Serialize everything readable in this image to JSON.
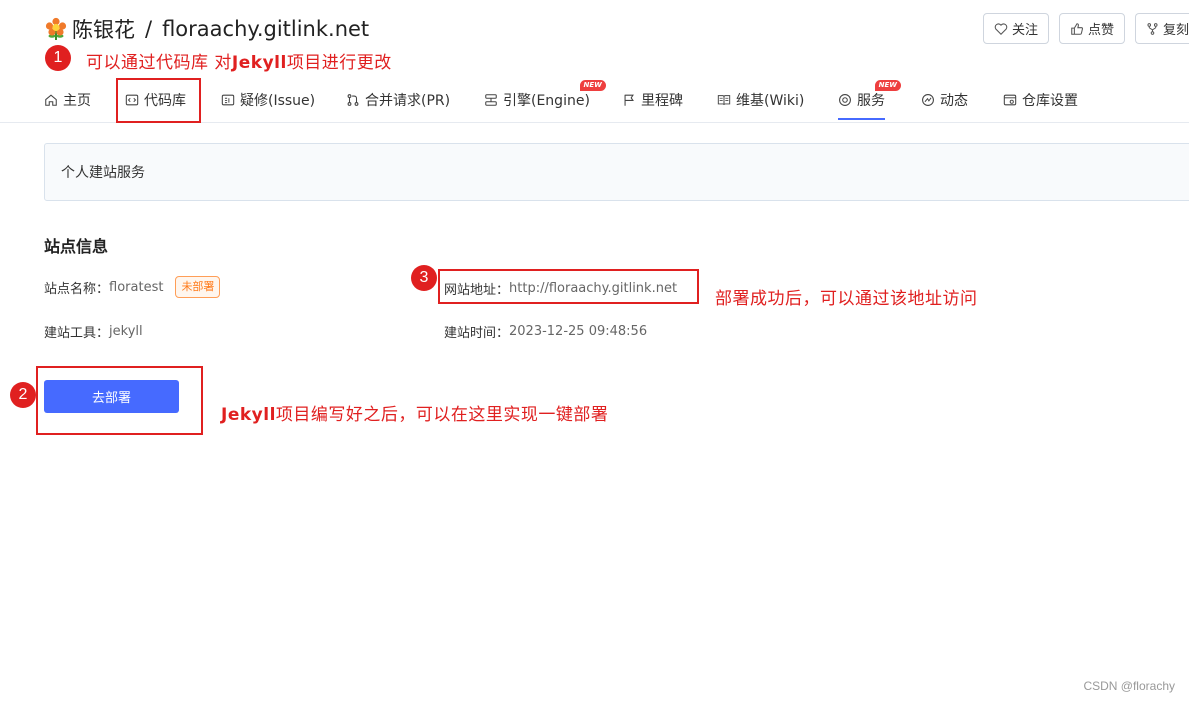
{
  "header": {
    "owner": "陈银花",
    "separator": "/",
    "repo": "floraachy.gitlink.net",
    "flower_icon": "flower-icon"
  },
  "actions": {
    "follow": "关注",
    "like": "点赞",
    "fork": "复刻"
  },
  "nav": {
    "items": [
      {
        "label": "主页",
        "icon": "home-icon"
      },
      {
        "label": "代码库",
        "icon": "code-icon"
      },
      {
        "label": "疑修(Issue)",
        "icon": "issue-icon"
      },
      {
        "label": "合并请求(PR)",
        "icon": "pull-request-icon"
      },
      {
        "label": "引擎(Engine)",
        "icon": "engine-icon",
        "badge": "NEW"
      },
      {
        "label": "里程碑",
        "icon": "flag-icon"
      },
      {
        "label": "维基(Wiki)",
        "icon": "book-icon"
      },
      {
        "label": "服务",
        "icon": "service-icon",
        "badge": "NEW"
      },
      {
        "label": "动态",
        "icon": "activity-icon"
      },
      {
        "label": "仓库设置",
        "icon": "settings-icon"
      }
    ]
  },
  "service_bar": {
    "label": "个人建站服务"
  },
  "site": {
    "section_title": "站点信息",
    "name_label": "站点名称：",
    "name_value": "floratest",
    "status_badge": "未部署",
    "address_label": "网站地址：",
    "address_value": "http://floraachy.gitlink.net",
    "tool_label": "建站工具：",
    "tool_value": "jekyll",
    "time_label": "建站时间：",
    "time_value": "2023-12-25 09:48:56",
    "deploy_button": "去部署"
  },
  "annotations": {
    "n1": "1",
    "n2": "2",
    "n3": "3",
    "t1_pre": "可以通过代码库 对",
    "t1_bold": "Jekyll",
    "t1_post": "项目进行更改",
    "t2_bold": "Jekyll",
    "t2_post": "项目编写好之后，可以在这里实现一键部署",
    "t3": "部署成功后，可以通过该地址访问"
  },
  "watermark": "CSDN @florachy",
  "colors": {
    "accent": "#466aff",
    "annotation": "#e02020",
    "badge_orange": "#ff7a1a",
    "new_badge": "#ee3f3f"
  }
}
